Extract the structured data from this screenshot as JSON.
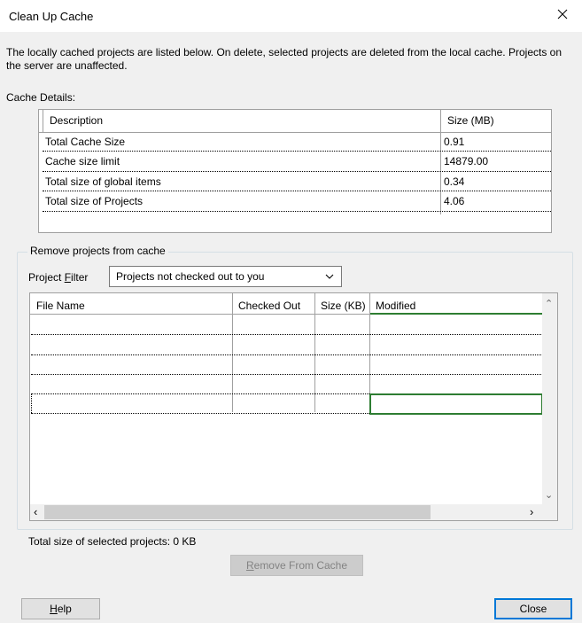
{
  "window": {
    "title": "Clean Up Cache",
    "close_icon": "close-icon"
  },
  "description": "The locally cached projects are listed below. On delete, selected projects are deleted from the local cache. Projects on the server are unaffected.",
  "cache_details": {
    "label": "Cache Details:",
    "columns": [
      "Description",
      "Size (MB)"
    ],
    "rows": [
      {
        "description": "Total Cache Size",
        "size": "0.91"
      },
      {
        "description": "Cache size limit",
        "size": "14879.00"
      },
      {
        "description": "Total size of global items",
        "size": "0.34"
      },
      {
        "description": "Total size of Projects",
        "size": "4.06"
      }
    ]
  },
  "remove_group": {
    "label": "Remove projects from cache",
    "filter_label_pre": "Project ",
    "filter_label_accel": "F",
    "filter_label_post": "ilter",
    "filter_value": "Projects not checked out to you",
    "columns": [
      "File Name",
      "Checked Out",
      "Size (KB)",
      "Modified"
    ],
    "rows": 5
  },
  "total_selected": "Total size of selected projects: 0 KB",
  "buttons": {
    "remove_accel": "R",
    "remove_rest": "emove From Cache",
    "help_accel": "H",
    "help_rest": "elp",
    "close": "Close"
  },
  "colors": {
    "selection": "#2e7d32",
    "default_button_border": "#0078d7"
  }
}
